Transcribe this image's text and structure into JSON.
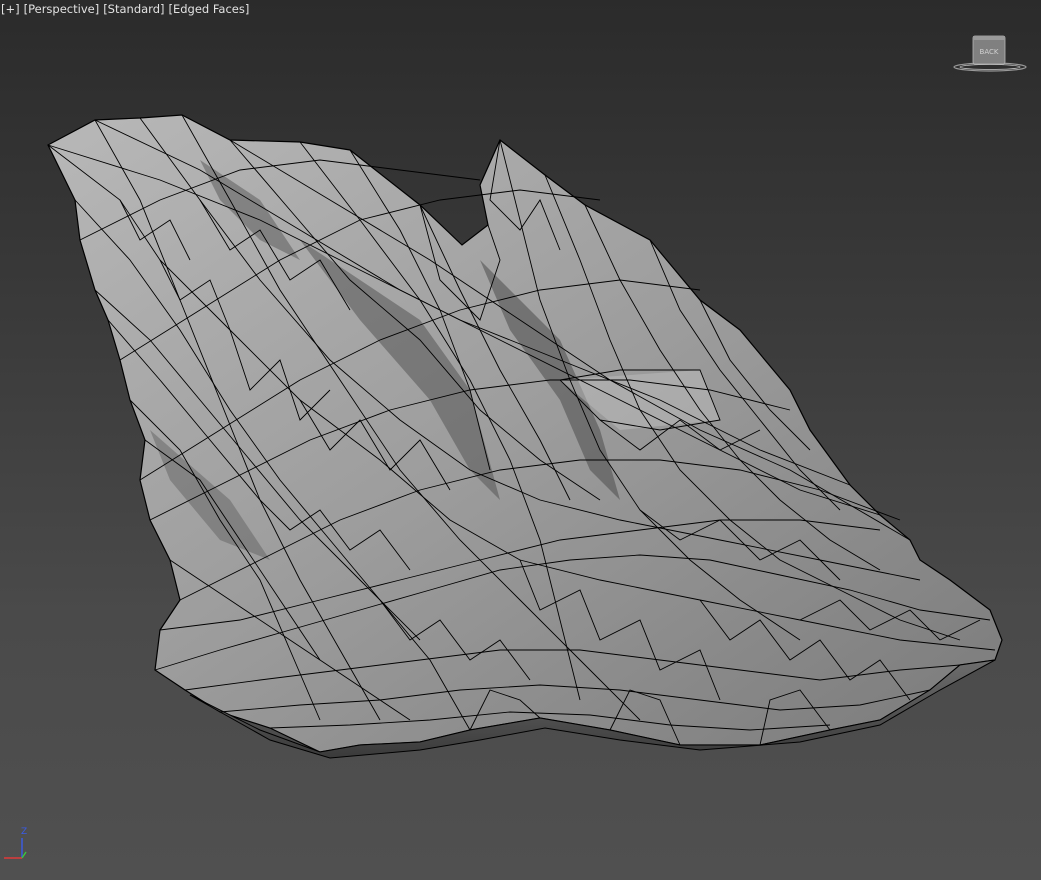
{
  "viewport": {
    "labels": {
      "plus_menu": "[+]",
      "view_menu": "[Perspective]",
      "shading_menu": "[Standard]",
      "display_menu": "[Edged Faces]"
    },
    "viewcube": {
      "face_label": "BACK",
      "icon": "viewcube-icon"
    },
    "axis_gizmo": {
      "z_label": "Z",
      "icon": "axis-tripod-icon"
    },
    "colors": {
      "background_top": "#2b2b2b",
      "background_bottom": "#505050",
      "mesh_fill": "#9a9a9a",
      "mesh_edges": "#000000",
      "label_text": "#e2e2e2"
    },
    "object": {
      "icon": "rock-mesh-icon"
    }
  }
}
